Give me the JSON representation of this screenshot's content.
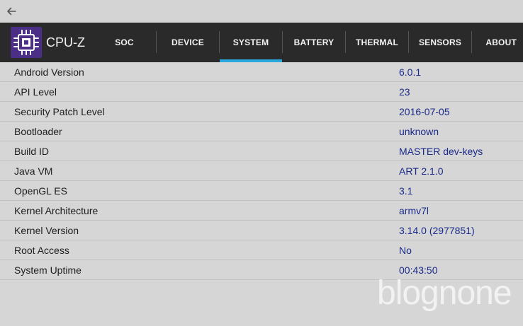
{
  "app": {
    "title": "CPU-Z"
  },
  "tabs": [
    {
      "label": "SOC"
    },
    {
      "label": "DEVICE"
    },
    {
      "label": "SYSTEM",
      "selected": true
    },
    {
      "label": "BATTERY"
    },
    {
      "label": "THERMAL"
    },
    {
      "label": "SENSORS"
    },
    {
      "label": "ABOUT"
    }
  ],
  "system": {
    "rows": [
      {
        "label": "Android Version",
        "value": "6.0.1"
      },
      {
        "label": "API Level",
        "value": "23"
      },
      {
        "label": "Security Patch Level",
        "value": "2016-07-05"
      },
      {
        "label": "Bootloader",
        "value": "unknown"
      },
      {
        "label": "Build ID",
        "value": "MASTER dev-keys"
      },
      {
        "label": "Java VM",
        "value": "ART 2.1.0"
      },
      {
        "label": "OpenGL ES",
        "value": "3.1"
      },
      {
        "label": "Kernel Architecture",
        "value": "armv7l"
      },
      {
        "label": "Kernel Version",
        "value": "3.14.0 (2977851)"
      },
      {
        "label": "Root Access",
        "value": "No"
      },
      {
        "label": "System Uptime",
        "value": "00:43:50"
      }
    ]
  },
  "watermark": {
    "text": "blognone"
  },
  "colors": {
    "app_bar": "#2a2a2a",
    "tab_indicator": "#29a9dd",
    "logo_background": "#4b2f86",
    "value_text": "#1a2a8a",
    "label_text": "#1d1d1d",
    "page_background": "#d6d6d6"
  },
  "icons": {
    "back": "arrow-left-icon",
    "logo": "cpu-chip-icon"
  }
}
